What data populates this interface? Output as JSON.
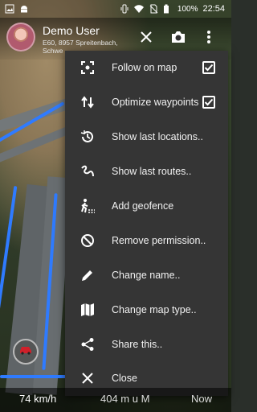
{
  "status_bar": {
    "battery": "100%",
    "time": "22:54"
  },
  "header": {
    "user_name": "Demo User",
    "address": "E60, 8957 Spreitenbach, Schwe",
    "close_icon": "close-icon",
    "camera_icon": "camera-icon",
    "more_icon": "more-vert-icon"
  },
  "menu": {
    "items": [
      {
        "label": "Follow on map",
        "icon": "follow-target-icon",
        "checked": true
      },
      {
        "label": "Optimize waypoints",
        "icon": "swap-vert-icon",
        "checked": true
      },
      {
        "label": "Show last locations..",
        "icon": "history-icon"
      },
      {
        "label": "Show last routes..",
        "icon": "route-icon"
      },
      {
        "label": "Add geofence",
        "icon": "geofence-walk-icon"
      },
      {
        "label": "Remove permission..",
        "icon": "block-icon"
      },
      {
        "label": "Change name..",
        "icon": "pencil-icon"
      },
      {
        "label": "Change map type..",
        "icon": "map-icon"
      },
      {
        "label": "Share this..",
        "icon": "share-icon"
      },
      {
        "label": "Close",
        "icon": "close-icon"
      }
    ]
  },
  "bottom_bar": {
    "speed": "74 km/h",
    "distance": "404 m u M",
    "time": "Now"
  },
  "colors": {
    "menu_bg": "#353535",
    "route_blue": "#2f7bff",
    "text": "#ffffff"
  }
}
